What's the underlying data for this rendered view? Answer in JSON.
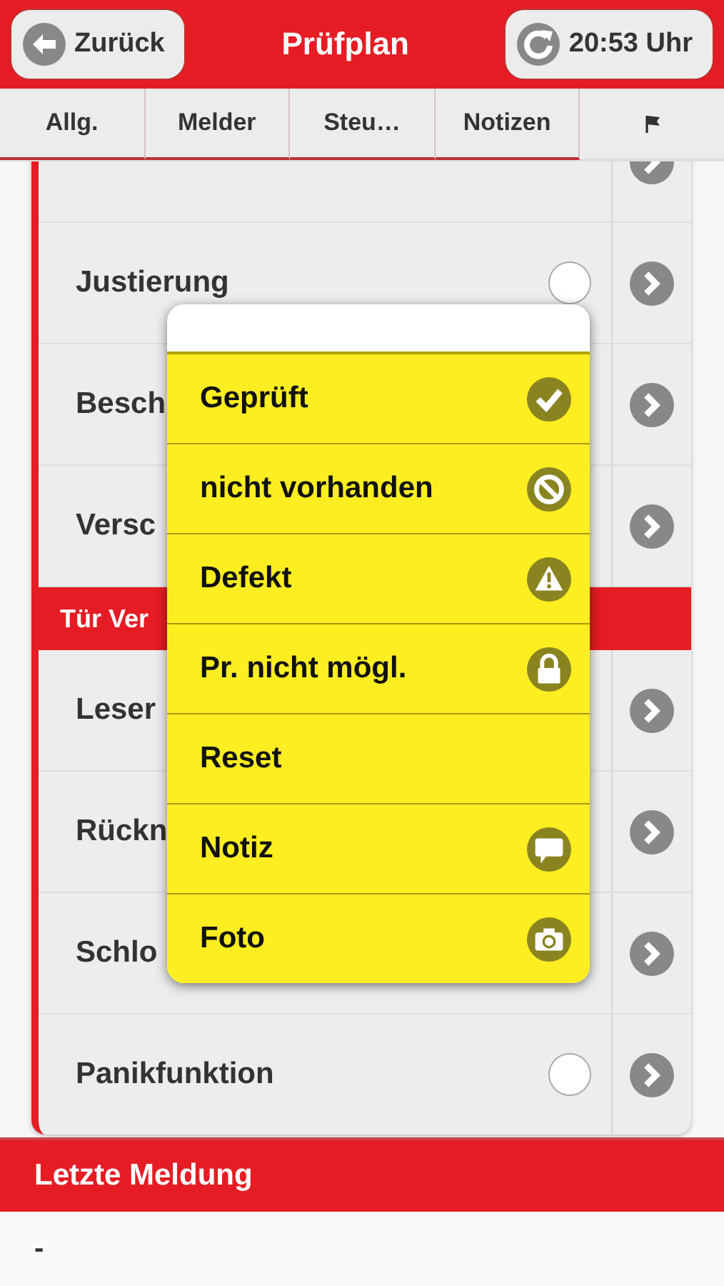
{
  "header": {
    "back_button": "Zurück",
    "title": "Prüfplan",
    "time_button": "20:53 Uhr"
  },
  "tabs": [
    {
      "label": "Allg.",
      "selected": false
    },
    {
      "label": "Melder",
      "selected": false
    },
    {
      "label": "Steu…",
      "selected": false
    },
    {
      "label": "Notizen",
      "selected": false
    },
    {
      "kind": "flag",
      "selected": false
    }
  ],
  "list": [
    {
      "kind": "row"
    },
    {
      "kind": "row",
      "label": "Justierung",
      "checked": false
    },
    {
      "kind": "row",
      "label": "Besch"
    },
    {
      "kind": "row",
      "label": "Versc"
    },
    {
      "kind": "section",
      "label": "Tür Ver"
    },
    {
      "kind": "row",
      "label": "Leser"
    },
    {
      "kind": "row",
      "label": "Rückn"
    },
    {
      "kind": "row",
      "label": "Schlo"
    },
    {
      "kind": "row",
      "label": "Panikfunktion",
      "checked": false
    }
  ],
  "popup_menu": [
    {
      "label": "Geprüft",
      "kind": "check"
    },
    {
      "label": "nicht vorhanden",
      "kind": "block"
    },
    {
      "label": "Defekt",
      "kind": "warning"
    },
    {
      "label": "Pr. nicht mögl.",
      "kind": "lock"
    },
    {
      "label": "Reset",
      "kind": "none"
    },
    {
      "label": "Notiz",
      "kind": "comment"
    },
    {
      "label": "Foto",
      "kind": "camera"
    }
  ],
  "last_message": {
    "title": "Letzte Meldung",
    "text": "-"
  }
}
